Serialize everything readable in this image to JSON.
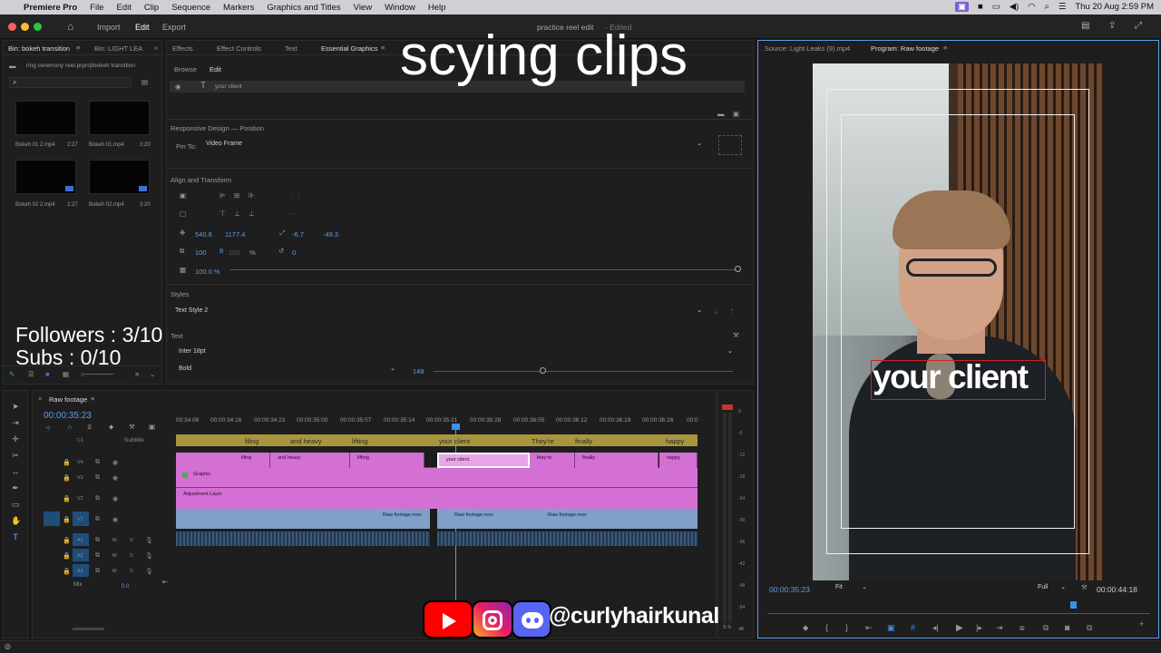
{
  "menubar": {
    "apple": "",
    "app": "Premiere Pro",
    "items": [
      "File",
      "Edit",
      "Clip",
      "Sequence",
      "Markers",
      "Graphics and Titles",
      "View",
      "Window",
      "Help"
    ],
    "clock": "Thu 20 Aug  2:59 PM"
  },
  "appbar": {
    "tabs": [
      "Import",
      "Edit",
      "Export"
    ],
    "active": "Edit",
    "project_title": "practice reel edit",
    "edited": "- Edited"
  },
  "bin_panel": {
    "tabs": [
      "Bin: bokeh transition",
      "Bin: LIGHT LEA"
    ],
    "path": "ring ceremony reel.prproj\\bokeh transition",
    "clips": [
      {
        "name": "Bokeh 01 2.mp4",
        "duration": "2:27"
      },
      {
        "name": "Bokeh 01.mp4",
        "duration": "3:20"
      },
      {
        "name": "Bokeh 02 2.mp4",
        "duration": "2:27"
      },
      {
        "name": "Bokeh 02.mp4",
        "duration": "3:20"
      }
    ]
  },
  "eg_panel": {
    "tabs": [
      "Effects",
      "Effect Controls",
      "Text",
      "Essential Graphics"
    ],
    "subtabs": [
      "Browse",
      "Edit"
    ],
    "layer": "your client",
    "responsive_label": "Responsive Design — Position",
    "pin_label": "Pin To:",
    "pin_value": "Video Frame",
    "align_label": "Align and Transform",
    "pos_x": "540.8",
    "pos_y": "1177.4",
    "anchor_x": "-6.7",
    "anchor_y": "-49.3",
    "scale": "100",
    "scale2": "100",
    "pct": "%",
    "rotation": "0",
    "opacity": "100.0 %",
    "styles_label": "Styles",
    "style_value": "Text Style 2",
    "text_label": "Text",
    "font": "Inter 18pt",
    "weight": "Bold",
    "size": "148"
  },
  "overlay": {
    "caption": "scying clips",
    "followers": "Followers : 3/10",
    "subs": "Subs : 0/10",
    "handle": "@curlyhairkunal"
  },
  "monitor": {
    "source_tab": "Source: Light Leaks (9).mp4",
    "program_tab": "Program: Raw footage",
    "timecode": "00:00:35:23",
    "fit": "Fit",
    "quality": "Full",
    "duration": "00:00:44:18",
    "caption_text": "your client"
  },
  "timeline": {
    "sequence": "Raw footage",
    "timecode": "00:00:35:23",
    "ruler": [
      "00:34:09",
      "00:00:34:16",
      "00:00:34:23",
      "00:00:35:00",
      "00:00:35:07",
      "00:00:35:14",
      "00:00:35:21",
      "00:00:35:28",
      "00:00:36:05",
      "00:00:36:12",
      "00:00:36:19",
      "00:00:36:26",
      "00:0"
    ],
    "subtitle_label": "Subtitle",
    "c1": "C1",
    "tracks": [
      "V4",
      "V3",
      "V2",
      "V1",
      "A1",
      "A2",
      "A3"
    ],
    "mix_label": "Mix",
    "mix_value": "0.0",
    "subtitles": [
      "filing",
      "and heavy",
      "lifting",
      "your client",
      "They're",
      "finally",
      "happy"
    ],
    "v4_clips": [
      "filing",
      "and heavy",
      "lifting.",
      "your client.",
      "they're",
      "finally",
      "happy"
    ],
    "graphic": "Graphic",
    "adjustment": "Adjustment Layer",
    "v1_clips": [
      "Raw footage.mov",
      "Raw footage.mov",
      "Raw footage.mov"
    ],
    "meter_labels": [
      "0",
      "-6",
      "-12",
      "-18",
      "-24",
      "-30",
      "-36",
      "-42",
      "-48",
      "-54",
      "dB"
    ],
    "ss_label": "S  S"
  },
  "colors": {
    "clip_pink": "#d46fd4",
    "clip_blue": "#7fa0c8",
    "subtitle_gold": "#a8953e",
    "accent": "#5a9ee8"
  }
}
